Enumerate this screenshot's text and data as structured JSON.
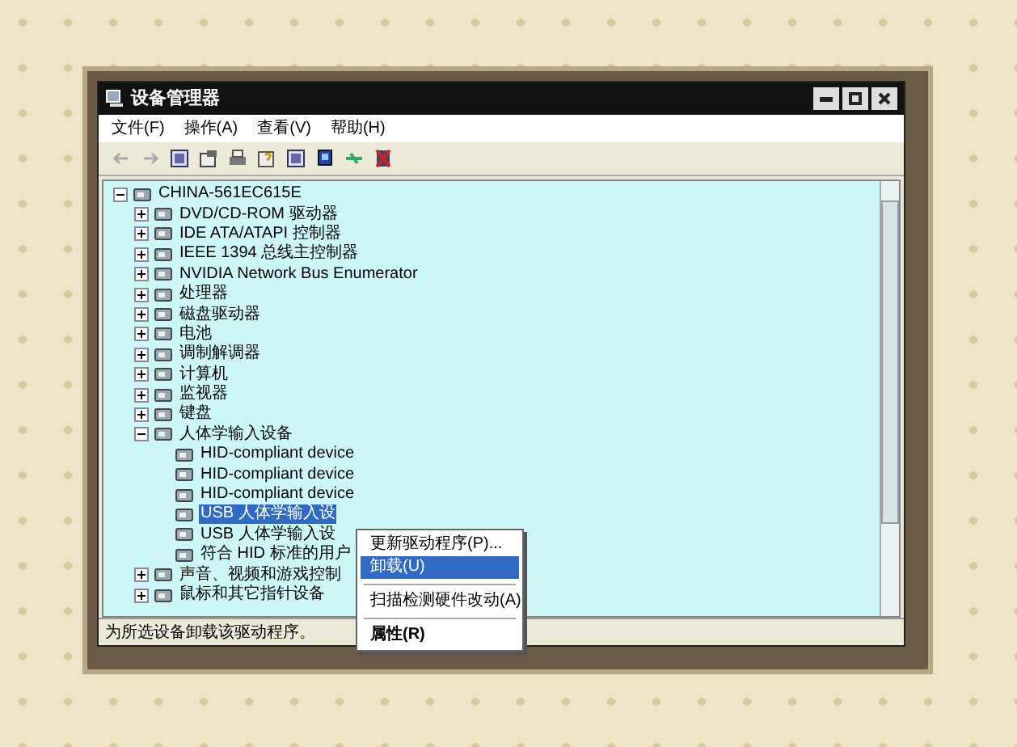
{
  "window": {
    "title": "设备管理器"
  },
  "menu": [
    "文件(F)",
    "操作(A)",
    "查看(V)",
    "帮助(H)"
  ],
  "tree": {
    "label": "CHINA-561EC615E",
    "expanded": true,
    "children": [
      {
        "label": "DVD/CD-ROM 驱动器",
        "expanded": false,
        "selected": false
      },
      {
        "label": "IDE ATA/ATAPI 控制器",
        "expanded": false,
        "selected": false
      },
      {
        "label": "IEEE 1394 总线主控制器",
        "expanded": false,
        "selected": false
      },
      {
        "label": "NVIDIA Network Bus Enumerator",
        "expanded": false,
        "selected": false
      },
      {
        "label": "处理器",
        "expanded": false,
        "selected": false
      },
      {
        "label": "磁盘驱动器",
        "expanded": false,
        "selected": false
      },
      {
        "label": "电池",
        "expanded": false,
        "selected": false
      },
      {
        "label": "调制解调器",
        "expanded": false,
        "selected": false
      },
      {
        "label": "计算机",
        "expanded": false,
        "selected": false
      },
      {
        "label": "监视器",
        "expanded": false,
        "selected": false
      },
      {
        "label": "键盘",
        "expanded": false,
        "selected": false
      },
      {
        "label": "人体学输入设备",
        "expanded": true,
        "selected": false,
        "children": [
          {
            "label": "HID-compliant device",
            "selected": false
          },
          {
            "label": "HID-compliant device",
            "selected": false
          },
          {
            "label": "HID-compliant device",
            "selected": false
          },
          {
            "label": "USB 人体学输入设",
            "selected": true
          },
          {
            "label": "USB 人体学输入设",
            "selected": false
          },
          {
            "label": "符合 HID 标准的用户",
            "selected": false
          }
        ]
      },
      {
        "label": "声音、视频和游戏控制",
        "expanded": false,
        "selected": false
      },
      {
        "label": "鼠标和其它指针设备",
        "expanded": false,
        "selected": false
      }
    ]
  },
  "context_menu": [
    {
      "kind": "item",
      "label": "更新驱动程序(P)...",
      "selected": false
    },
    {
      "kind": "item",
      "label": "卸载(U)",
      "selected": true
    },
    {
      "kind": "separator"
    },
    {
      "kind": "item",
      "label": "扫描检测硬件改动(A)",
      "selected": false
    },
    {
      "kind": "separator"
    },
    {
      "kind": "bold",
      "label": "属性(R)",
      "selected": false
    }
  ],
  "status_bar": "为所选设备卸载该驱动程序。"
}
